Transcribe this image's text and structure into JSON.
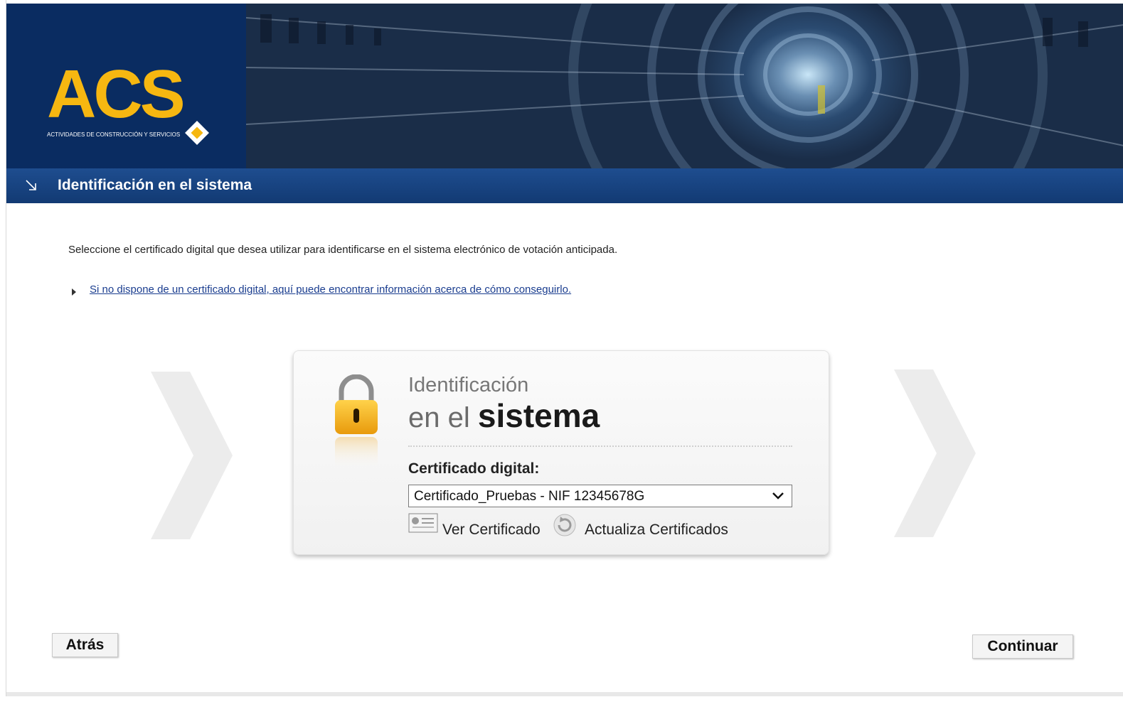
{
  "header": {
    "logo_text": "ACS",
    "logo_subtitle": "ACTIVIDADES DE CONSTRUCCIÓN Y SERVICIOS"
  },
  "titlebar": {
    "title": "Identificación en el sistema"
  },
  "intro": {
    "text": "Seleccione el certificado digital que desea utilizar para identificarse en el sistema electrónico de votación anticipada.",
    "link": "Si no dispone de un certificado digital, aquí puede encontrar información acerca de cómo conseguirlo."
  },
  "card": {
    "title_line1": "Identificación",
    "title_line2_prefix": "en el",
    "title_line2_bold": "sistema",
    "cert_label": "Certificado digital:",
    "cert_selected": "Certificado_Pruebas - NIF 12345678G",
    "view_cert": "Ver Certificado",
    "refresh_certs": "Actualiza Certificados"
  },
  "buttons": {
    "back": "Atrás",
    "next": "Continuar"
  },
  "colors": {
    "brand_navy": "#0a2c61",
    "brand_yellow": "#f6b711",
    "link": "#1a3d8f"
  }
}
